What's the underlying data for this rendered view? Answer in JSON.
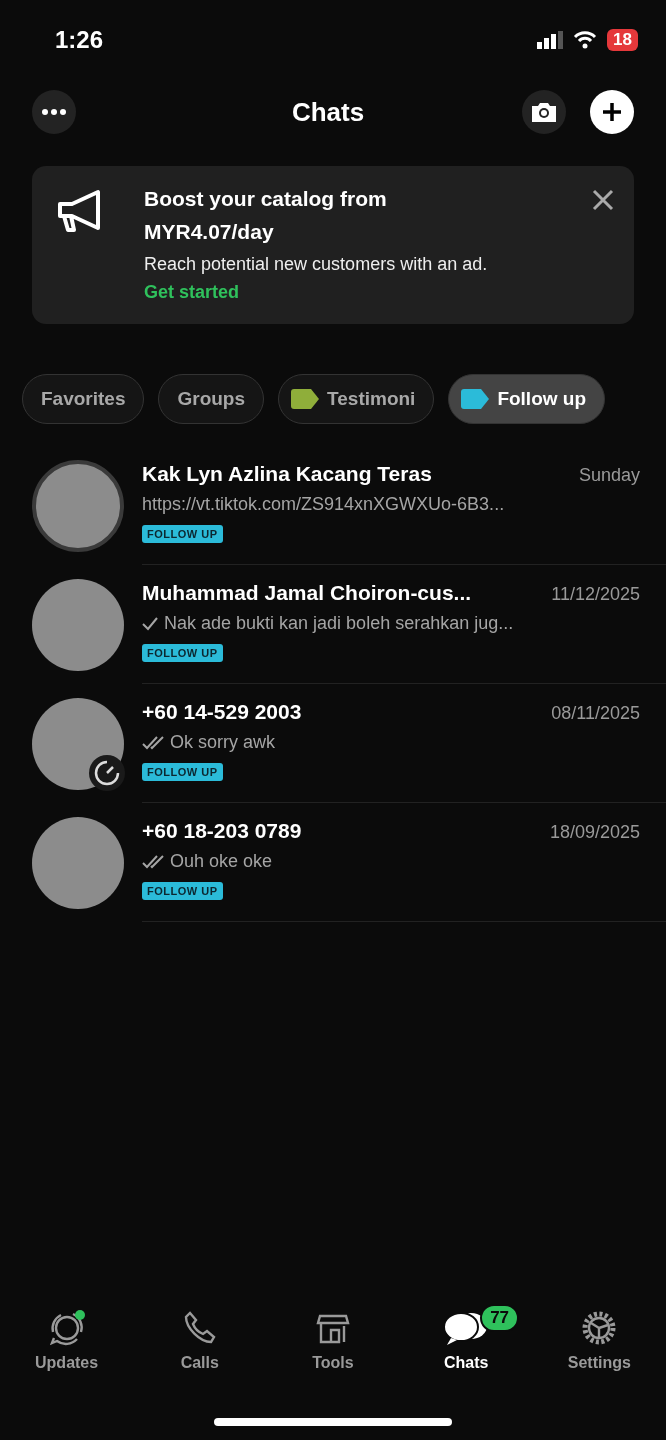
{
  "status_bar": {
    "time": "1:26",
    "battery": "18"
  },
  "header": {
    "title": "Chats"
  },
  "banner": {
    "title": "Boost your catalog from MYR4.07/day",
    "body": "Reach potential new customers with an ad.",
    "link": "Get started"
  },
  "filters": [
    {
      "label": "Favorites",
      "selected": false
    },
    {
      "label": "Groups",
      "selected": false
    },
    {
      "label": "Testimoni",
      "selected": false,
      "color": "#8fae3a"
    },
    {
      "label": "Follow up",
      "selected": true,
      "color": "#2bbbd9"
    }
  ],
  "chats": [
    {
      "name": "Kak Lyn Azlina Kacang Teras",
      "time": "Sunday",
      "preview": "https://vt.tiktok.com/ZS914xnXGWXUo-6B3...",
      "sent": false,
      "status_ring": true,
      "timer": false,
      "tag": "FOLLOW UP"
    },
    {
      "name": "Muhammad Jamal Choiron-cus...",
      "time": "11/12/2025",
      "preview": "Nak ade bukti kan  jadi boleh serahkan jug...",
      "sent": true,
      "read": false,
      "status_ring": false,
      "timer": false,
      "tag": "FOLLOW UP"
    },
    {
      "name": "+60 14-529 2003",
      "time": "08/11/2025",
      "preview": "Ok sorry awk",
      "sent": true,
      "read": true,
      "status_ring": false,
      "timer": true,
      "tag": "FOLLOW UP"
    },
    {
      "name": "+60 18-203 0789",
      "time": "18/09/2025",
      "preview": "Ouh oke oke",
      "sent": true,
      "read": true,
      "status_ring": false,
      "timer": false,
      "tag": "FOLLOW UP"
    }
  ],
  "tabs": [
    {
      "kind": "updates",
      "label": "Updates",
      "selected": false,
      "dot": true
    },
    {
      "kind": "calls",
      "label": "Calls",
      "selected": false
    },
    {
      "kind": "tools",
      "label": "Tools",
      "selected": false
    },
    {
      "kind": "chats",
      "label": "Chats",
      "selected": true,
      "badge": "77"
    },
    {
      "kind": "settings",
      "label": "Settings",
      "selected": false
    }
  ]
}
